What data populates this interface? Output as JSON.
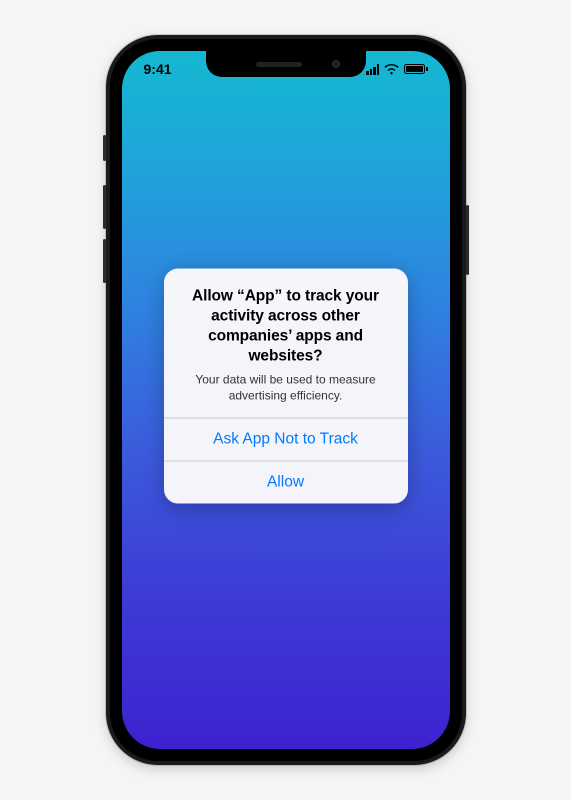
{
  "status": {
    "time": "9:41"
  },
  "alert": {
    "title": "Allow “App” to track your activity across other companies’ apps and websites?",
    "message": "Your data will be used to measure advertising efficiency.",
    "deny_label": "Ask App Not to Track",
    "allow_label": "Allow"
  }
}
